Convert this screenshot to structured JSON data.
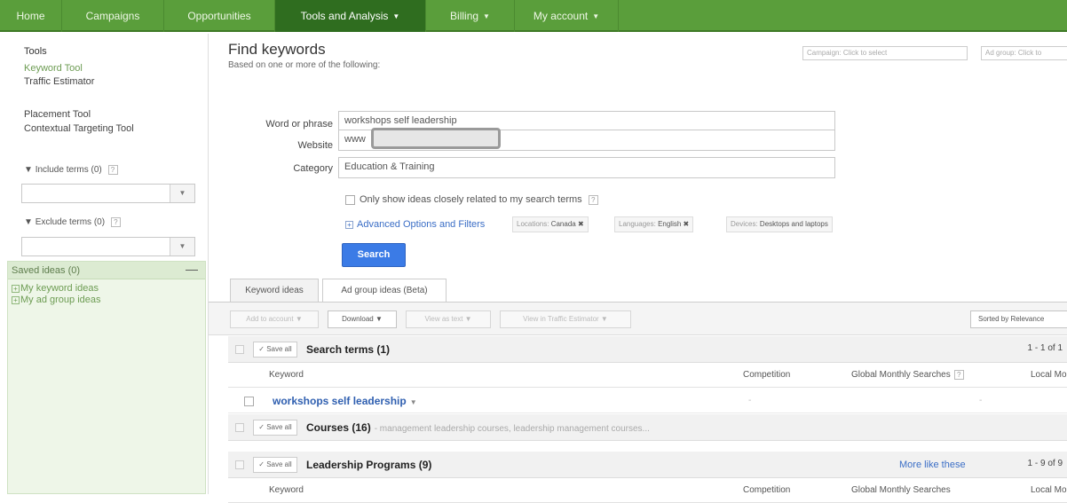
{
  "nav": {
    "tabs": [
      {
        "label": "Home"
      },
      {
        "label": "Campaigns"
      },
      {
        "label": "Opportunities"
      },
      {
        "label": "Tools and Analysis",
        "caret": "▼"
      },
      {
        "label": "Billing",
        "caret": "▼"
      },
      {
        "label": "My account",
        "caret": "▼"
      }
    ]
  },
  "sidebar": {
    "tools_heading": "Tools",
    "keyword_tool": "Keyword Tool",
    "traffic_estimator": "Traffic Estimator",
    "placement_tool": "Placement Tool",
    "contextual_targeting_tool": "Contextual Targeting Tool",
    "include_terms": "Include terms (0)",
    "exclude_terms": "Exclude terms (0)",
    "help": "?",
    "saved_ideas": "Saved ideas (0)",
    "saved_collapse": "—",
    "saved_items": [
      "My keyword ideas",
      "My ad group ideas"
    ]
  },
  "main": {
    "title": "Find keywords",
    "subtitle": "Based on one or more of the following:",
    "campaign_field": "Campaign: Click to select",
    "adgroup_field": "Ad group: Click to",
    "word_label": "Word or phrase",
    "word_value": "workshops self leadership",
    "website_label": "Website",
    "website_value": "www",
    "category_label": "Category",
    "category_value": "Education & Training",
    "only_show": "Only show ideas closely related to my search terms",
    "advanced": "Advanced Options and Filters",
    "filters": [
      {
        "key": "Locations:",
        "value": "Canada ✖"
      },
      {
        "key": "Languages:",
        "value": "English ✖"
      },
      {
        "key": "Devices:",
        "value": "Desktops and laptops"
      }
    ],
    "search_button": "Search"
  },
  "tabs": [
    "Keyword ideas",
    "Ad group ideas (Beta)"
  ],
  "toolbar": {
    "add_to_account": "Add to account ▼",
    "download": "Download ▼",
    "view_as_text": "View as text ▼",
    "view_in_traffic": "View in Traffic Estimator ▼",
    "sorted_by": "Sorted by Relevance"
  },
  "table": {
    "save_all": "✓ Save all",
    "search_terms": "Search terms (1)",
    "search_terms_count": "1 - 1 of 1",
    "col_keyword": "Keyword",
    "col_competition": "Competition",
    "col_global": "Global Monthly Searches",
    "col_local": "Local Mont",
    "keyword_row": "workshops self leadership",
    "keyword_competition": "-",
    "keyword_global": "-",
    "courses": "Courses (16)",
    "courses_sub": "- management leadership courses, leadership management courses...",
    "leadership": "Leadership Programs (9)",
    "more_like_these": "More like these",
    "leadership_count": "1 - 9 of 9",
    "col_keyword2": "Keyword",
    "col_competition2": "Competition",
    "col_global2": "Global Monthly Searches",
    "col_local2": "Local Mont"
  }
}
